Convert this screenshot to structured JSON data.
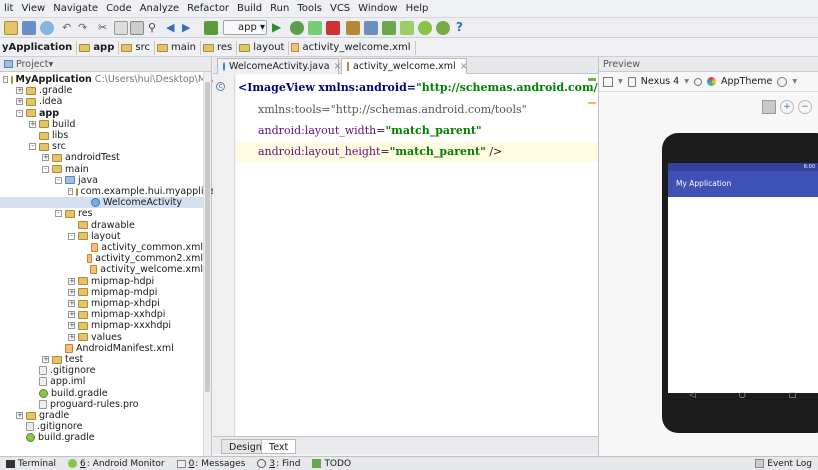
{
  "menu": [
    "lit",
    "View",
    "Navigate",
    "Code",
    "Analyze",
    "Refactor",
    "Build",
    "Run",
    "Tools",
    "VCS",
    "Window",
    "Help"
  ],
  "toolbar": {
    "run_config": "app",
    "help": "?"
  },
  "breadcrumb": [
    "yApplication",
    "app",
    "src",
    "main",
    "res",
    "layout",
    "activity_welcome.xml"
  ],
  "project_panel": {
    "title": "Project"
  },
  "tree": [
    {
      "label": "MyApplication",
      "path": "C:\\Users\\hui\\Desktop\\MyApp",
      "indent": 0,
      "icon": "folder",
      "exp": "-",
      "bold": true
    },
    {
      "label": ".gradle",
      "indent": 1,
      "icon": "folder",
      "exp": "+"
    },
    {
      "label": ".idea",
      "indent": 1,
      "icon": "folder",
      "exp": "+"
    },
    {
      "label": "app",
      "indent": 1,
      "icon": "folder",
      "exp": "-",
      "bold": true
    },
    {
      "label": "build",
      "indent": 2,
      "icon": "folder",
      "exp": "+"
    },
    {
      "label": "libs",
      "indent": 2,
      "icon": "folder",
      "exp": ""
    },
    {
      "label": "src",
      "indent": 2,
      "icon": "folder",
      "exp": "-"
    },
    {
      "label": "androidTest",
      "indent": 3,
      "icon": "folder",
      "exp": "+"
    },
    {
      "label": "main",
      "indent": 3,
      "icon": "folder",
      "exp": "-"
    },
    {
      "label": "java",
      "indent": 4,
      "icon": "src",
      "exp": "-"
    },
    {
      "label": "com.example.hui.myapplication",
      "indent": 5,
      "icon": "folder",
      "exp": "-"
    },
    {
      "label": "WelcomeActivity",
      "indent": 6,
      "icon": "java",
      "exp": "",
      "sel": true
    },
    {
      "label": "res",
      "indent": 4,
      "icon": "folder",
      "exp": "-"
    },
    {
      "label": "drawable",
      "indent": 5,
      "icon": "folder",
      "exp": ""
    },
    {
      "label": "layout",
      "indent": 5,
      "icon": "folder",
      "exp": "-"
    },
    {
      "label": "activity_common.xml",
      "indent": 6,
      "icon": "xml",
      "exp": ""
    },
    {
      "label": "activity_common2.xml",
      "indent": 6,
      "icon": "xml",
      "exp": ""
    },
    {
      "label": "activity_welcome.xml",
      "indent": 6,
      "icon": "xml",
      "exp": ""
    },
    {
      "label": "mipmap-hdpi",
      "indent": 5,
      "icon": "folder",
      "exp": "+"
    },
    {
      "label": "mipmap-mdpi",
      "indent": 5,
      "icon": "folder",
      "exp": "+"
    },
    {
      "label": "mipmap-xhdpi",
      "indent": 5,
      "icon": "folder",
      "exp": "+"
    },
    {
      "label": "mipmap-xxhdpi",
      "indent": 5,
      "icon": "folder",
      "exp": "+"
    },
    {
      "label": "mipmap-xxxhdpi",
      "indent": 5,
      "icon": "folder",
      "exp": "+"
    },
    {
      "label": "values",
      "indent": 5,
      "icon": "folder",
      "exp": "+"
    },
    {
      "label": "AndroidManifest.xml",
      "indent": 4,
      "icon": "xml",
      "exp": ""
    },
    {
      "label": "test",
      "indent": 3,
      "icon": "folder",
      "exp": "+"
    },
    {
      "label": ".gitignore",
      "indent": 2,
      "icon": "file",
      "exp": ""
    },
    {
      "label": "app.iml",
      "indent": 2,
      "icon": "file",
      "exp": ""
    },
    {
      "label": "build.gradle",
      "indent": 2,
      "icon": "gradle",
      "exp": ""
    },
    {
      "label": "proguard-rules.pro",
      "indent": 2,
      "icon": "file",
      "exp": ""
    },
    {
      "label": "gradle",
      "indent": 1,
      "icon": "folder",
      "exp": "+"
    },
    {
      "label": ".gitignore",
      "indent": 1,
      "icon": "file",
      "exp": ""
    },
    {
      "label": "build.gradle",
      "indent": 1,
      "icon": "gradle",
      "exp": ""
    }
  ],
  "editor_tabs": [
    "WelcomeActivity.java",
    "activity_welcome.xml"
  ],
  "code": {
    "l1_tag": "ImageView",
    "l1_attr": "xmlns:android",
    "l1_val": "\"http://schemas.android.com/apk/r",
    "l2_attr": "xmlns:tools",
    "l2_val": "\"http://schemas.android.com/tools\"",
    "l3_attr": "android:layout_width",
    "l3_val": "\"match_parent\"",
    "l4_attr": "android:layout_height",
    "l4_val": "\"match_parent\"",
    "l4_end": " />"
  },
  "design_tabs": [
    "Design",
    "Text"
  ],
  "preview": {
    "title": "Preview",
    "device": "Nexus 4",
    "theme": "AppTheme",
    "app_title": "My Application",
    "time": "6:00"
  },
  "bottom": [
    {
      "key": "",
      "label": "Terminal"
    },
    {
      "key": "6",
      "label": "Android Monitor"
    },
    {
      "key": "0",
      "label": "Messages"
    },
    {
      "key": "3",
      "label": "Find"
    },
    {
      "key": "",
      "label": "TODO"
    },
    {
      "key": "",
      "label": "Event Log"
    }
  ],
  "colors": {
    "accent": "#3f51b5",
    "status": "#3340a0"
  }
}
